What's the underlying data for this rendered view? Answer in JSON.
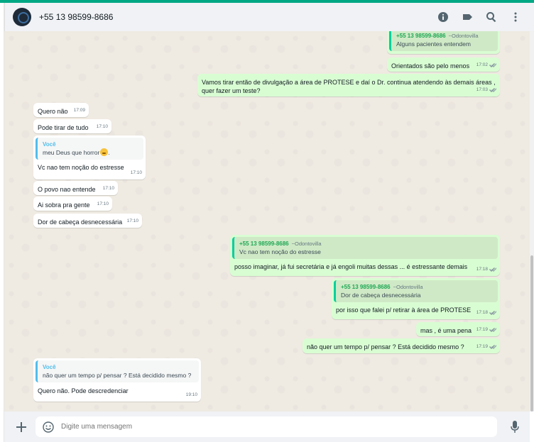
{
  "header": {
    "contact_name": "+55 13 98599-8686"
  },
  "input": {
    "placeholder": "Digite uma mensagem"
  },
  "icons": {
    "header": [
      "info-icon",
      "label-icon",
      "search-icon",
      "menu-icon"
    ],
    "footer": [
      "plus-icon",
      "emoji-icon",
      "mic-icon"
    ]
  },
  "colors": {
    "accent": "#00a884",
    "incoming_bubble": "#ffffff",
    "outgoing_bubble": "#d9fdd3",
    "chat_background": "#efeae2",
    "quote_author_outgoing": "#1fa855",
    "quote_author_incoming": "#53bdeb"
  },
  "messages": [
    {
      "direction": "out",
      "quote_author": "+55 13 98599-8686",
      "quote_pushname": "~Odontovilla",
      "quote_text": "Alguns pacientes entendem",
      "text": "",
      "time": ""
    },
    {
      "direction": "out",
      "text": "Orientados são pelo menos",
      "time": "17:02"
    },
    {
      "direction": "out",
      "text": "Vamos tirar então de divulgação a área de PROTESE e daí o Dr. continua atendendo às demais áreas , quer fazer um teste?",
      "time": "17:03"
    },
    {
      "direction": "in",
      "text": "Quero não",
      "time": "17:09"
    },
    {
      "direction": "in",
      "text": "Pode tirar de tudo",
      "time": "17:10"
    },
    {
      "direction": "in",
      "quote_author": "Você",
      "quote_text": "meu Deus que horror",
      "text": "Vc nao tem noção do estresse",
      "time": "17:10"
    },
    {
      "direction": "in",
      "text": "O povo nao entende",
      "time": "17:10"
    },
    {
      "direction": "in",
      "text": "Ai sobra pra gente",
      "time": "17:10"
    },
    {
      "direction": "in",
      "text": "Dor de cabeça desnecessária",
      "time": "17:10"
    },
    {
      "direction": "out",
      "quote_author": "+55 13 98599-8686",
      "quote_pushname": "~Odontovilla",
      "quote_text": "Vc nao tem noção do estresse",
      "text": "posso imaginar, já fui secretária e já engoli muitas dessas ... é estressante demais",
      "time": "17:18"
    },
    {
      "direction": "out",
      "quote_author": "+55 13 98599-8686",
      "quote_pushname": "~Odontovilla",
      "quote_text": "Dor de cabeça desnecessária",
      "text": "por isso que falei p/ retirar à área de PROTESE",
      "time": "17:18"
    },
    {
      "direction": "out",
      "text": "mas , é uma pena",
      "time": "17:19"
    },
    {
      "direction": "out",
      "text": "não quer um tempo p/ pensar ? Está decidido mesmo ?",
      "time": "17:19"
    },
    {
      "direction": "in",
      "quote_author": "Você",
      "quote_text": "não quer um tempo p/ pensar ? Está decidido mesmo ?",
      "text": "Quero não. Pode descredenciar",
      "time": "19:10"
    }
  ]
}
